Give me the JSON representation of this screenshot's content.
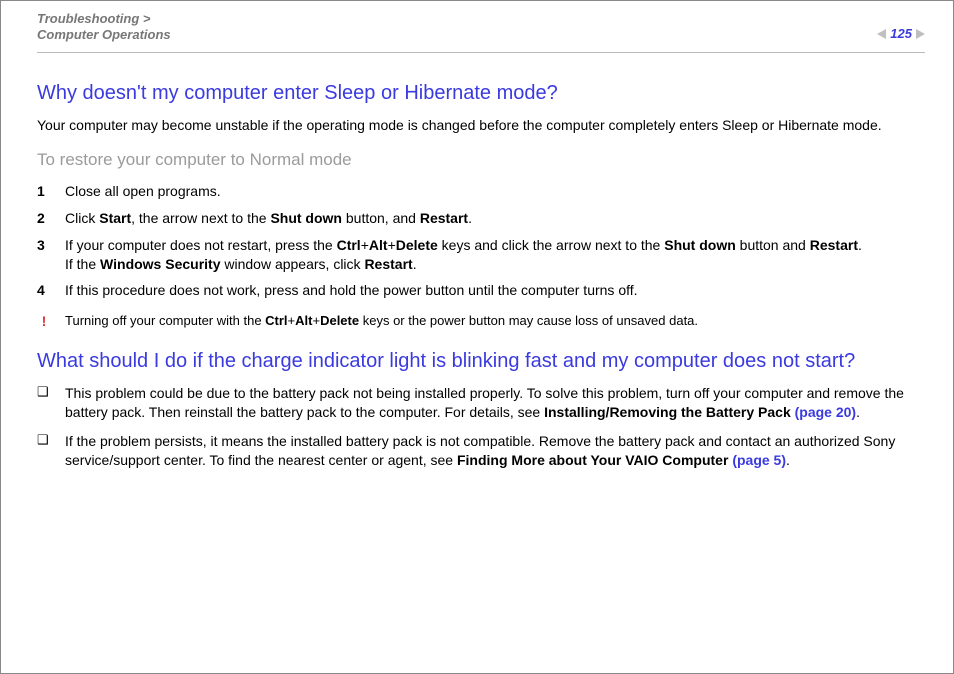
{
  "breadcrumb": {
    "line1": "Troubleshooting >",
    "line2": "Computer Operations"
  },
  "page_number": "125",
  "section1": {
    "heading": "Why doesn't my computer enter Sleep or Hibernate mode?",
    "intro": "Your computer may become unstable if the operating mode is changed before the computer completely enters Sleep or Hibernate mode.",
    "subheading": "To restore your computer to Normal mode",
    "steps": [
      {
        "n": "1",
        "text": "Close all open programs."
      },
      {
        "n": "2",
        "pre": "Click ",
        "b1": "Start",
        "mid1": ", the arrow next to the ",
        "b2": "Shut down",
        "mid2": " button, and ",
        "b3": "Restart",
        "tail": "."
      },
      {
        "n": "3",
        "l1_pre": "If your computer does not restart, press the ",
        "l1_b1": "Ctrl",
        "l1_plus1": "+",
        "l1_b2": "Alt",
        "l1_plus2": "+",
        "l1_b3": "Delete",
        "l1_mid": " keys and click the arrow next to the ",
        "l1_b4": "Shut down",
        "l1_mid2": " button and ",
        "l1_b5": "Restart",
        "l1_tail": ".",
        "l2_pre": "If the ",
        "l2_b1": "Windows Security",
        "l2_mid": " window appears, click ",
        "l2_b2": "Restart",
        "l2_tail": "."
      },
      {
        "n": "4",
        "text": "If this procedure does not work, press and hold the power button until the computer turns off."
      }
    ],
    "warning": {
      "mark": "!",
      "pre": "Turning off your computer with the ",
      "b1": "Ctrl",
      "plus1": "+",
      "b2": "Alt",
      "plus2": "+",
      "b3": "Delete",
      "tail": " keys or the power button may cause loss of unsaved data."
    }
  },
  "section2": {
    "heading": "What should I do if the charge indicator light is blinking fast and my computer does not start?",
    "bullets": [
      {
        "mk": "❑",
        "pre": "This problem could be due to the battery pack not being installed properly. To solve this problem, turn off your computer and remove the battery pack. Then reinstall the battery pack to the computer. For details, see ",
        "b1": "Installing/Removing the Battery Pack ",
        "link": "(page 20)",
        "tail": "."
      },
      {
        "mk": "❑",
        "pre": "If the problem persists, it means the installed battery pack is not compatible. Remove the battery pack and contact an authorized Sony service/support center. To find the nearest center or agent, see ",
        "b1": "Finding More about Your VAIO Computer ",
        "link": "(page 5)",
        "tail": "."
      }
    ]
  }
}
